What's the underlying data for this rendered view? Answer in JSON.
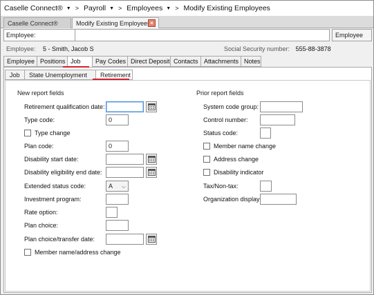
{
  "breadcrumb": {
    "items": [
      {
        "label": "Caselle Connect®",
        "has_dropdown": true
      },
      {
        "label": "Payroll",
        "has_dropdown": true
      },
      {
        "label": "Employees",
        "has_dropdown": true
      },
      {
        "label": "Modify Existing Employees",
        "has_dropdown": false
      }
    ]
  },
  "window_tabs": [
    {
      "label": "Caselle Connect®",
      "active": false
    },
    {
      "label": "Modify Existing Employees",
      "active": true,
      "close_icon": "close-icon"
    }
  ],
  "employee_bar": {
    "label": "Employee:",
    "value": "",
    "mode": "Employee"
  },
  "info": {
    "employee_label": "Employee:",
    "employee_value": "5 - Smith, Jacob S",
    "ssn_label": "Social Security number:",
    "ssn_value": "555-88-3878"
  },
  "main_tabs": [
    "Employee",
    "Positions",
    "Job",
    "Pay Codes",
    "Direct Deposit",
    "Contacts",
    "Attachments",
    "Notes"
  ],
  "main_tab_active": "Job",
  "sub_tabs": [
    "Job",
    "State Unemployment",
    "Retirement"
  ],
  "sub_tab_active": "Retirement",
  "accent_color": "#d11f2a",
  "new_fields": {
    "title": "New report fields",
    "retirement_qualification_date": {
      "label": "Retirement qualification date:",
      "value": ""
    },
    "type_code": {
      "label": "Type code:",
      "value": "0"
    },
    "type_change": {
      "label": "Type change",
      "checked": false
    },
    "plan_code": {
      "label": "Plan code:",
      "value": "0"
    },
    "disability_start_date": {
      "label": "Disability start date:",
      "value": ""
    },
    "disability_eligibility_end_date": {
      "label": "Disability eligibility end date:",
      "value": ""
    },
    "extended_status_code": {
      "label": "Extended status code:",
      "value": "A"
    },
    "investment_program": {
      "label": "Investment program:",
      "value": ""
    },
    "rate_option": {
      "label": "Rate option:",
      "value": ""
    },
    "plan_choice": {
      "label": "Plan choice:",
      "value": ""
    },
    "plan_choice_transfer_date": {
      "label": "Plan choice/transfer date:",
      "value": ""
    },
    "member_name_address_change": {
      "label": "Member name/address change",
      "checked": false
    }
  },
  "prior_fields": {
    "title": "Prior report fields",
    "system_code_group": {
      "label": "System code group:",
      "value": ""
    },
    "control_number": {
      "label": "Control number:",
      "value": ""
    },
    "status_code": {
      "label": "Status code:",
      "value": ""
    },
    "member_name_change": {
      "label": "Member name change",
      "checked": false
    },
    "address_change": {
      "label": "Address change",
      "checked": false
    },
    "disability_indicator": {
      "label": "Disability indicator",
      "checked": false
    },
    "tax_non_tax": {
      "label": "Tax/Non-tax:",
      "value": ""
    },
    "organization_display": {
      "label": "Organization display:",
      "value": ""
    }
  }
}
